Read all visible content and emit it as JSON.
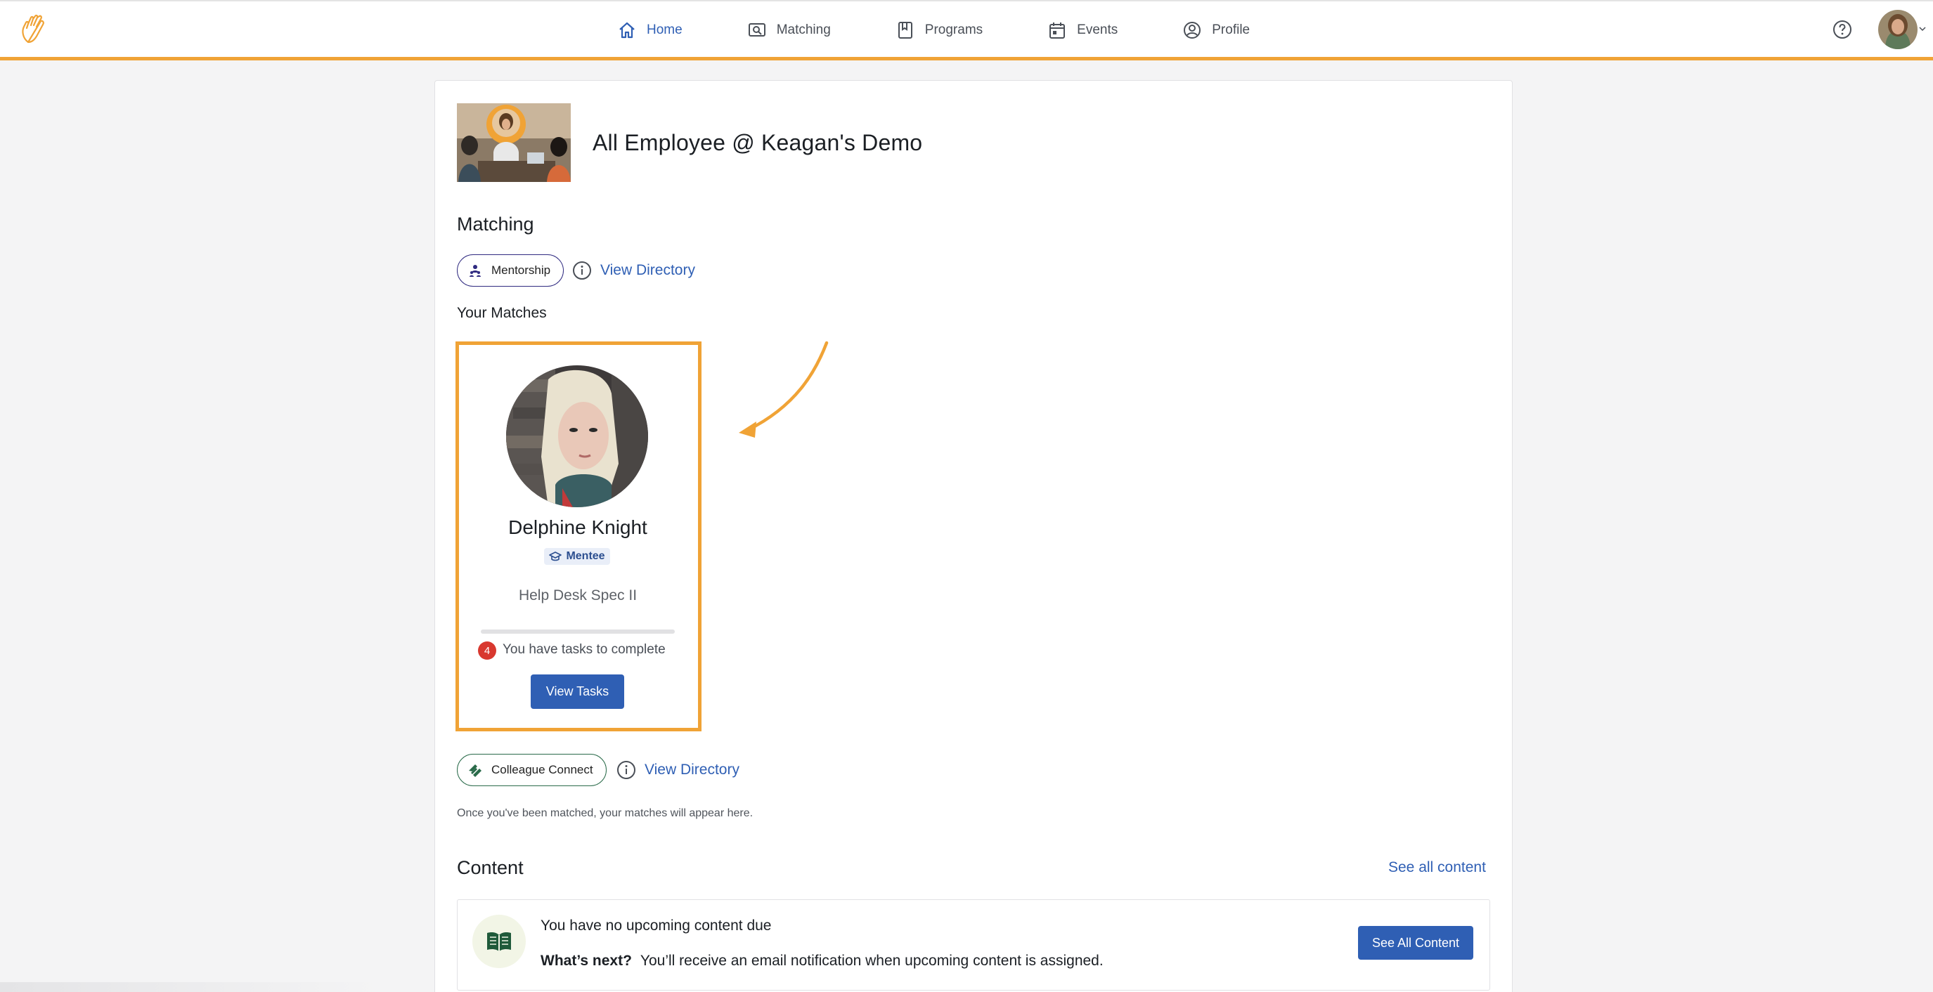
{
  "nav": {
    "items": [
      {
        "label": "Home",
        "icon": "home-icon",
        "active": true
      },
      {
        "label": "Matching",
        "icon": "matching-icon",
        "active": false
      },
      {
        "label": "Programs",
        "icon": "book-icon",
        "active": false
      },
      {
        "label": "Events",
        "icon": "calendar-icon",
        "active": false
      },
      {
        "label": "Profile",
        "icon": "user-circle-icon",
        "active": false
      }
    ],
    "accent_color": "#f0a336",
    "active_color": "#2f5fb4"
  },
  "group": {
    "title": "All Employee @ Keagan's Demo"
  },
  "matching": {
    "title": "Matching",
    "mentorship_chip": "Mentorship",
    "view_directory_1": "View Directory",
    "your_matches": "Your Matches",
    "match": {
      "name": "Delphine Knight",
      "badge": "Mentee",
      "role": "Help Desk Spec II",
      "progress": 0,
      "task_count": "4",
      "task_text": "You have tasks to complete",
      "button": "View Tasks"
    },
    "colleague_chip": "Colleague Connect",
    "view_directory_2": "View Directory",
    "note": "Once you've been matched, your matches will appear here."
  },
  "content": {
    "title": "Content",
    "see_all_link": "See all content",
    "empty_title": "You have no upcoming content due",
    "whats_next_label": "What’s next?",
    "whats_next_text": "You’ll receive an email notification when upcoming content is assigned.",
    "button": "See All Content"
  }
}
